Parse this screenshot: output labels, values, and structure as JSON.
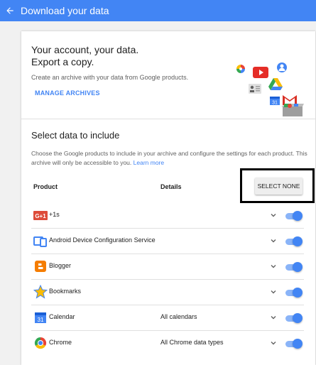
{
  "appbar": {
    "title": "Download your data"
  },
  "hero": {
    "heading_line1": "Your account, your data.",
    "heading_line2": "Export a copy.",
    "subtitle": "Create an archive with your data from Google products.",
    "manage_label": "MANAGE ARCHIVES"
  },
  "select": {
    "title": "Select data to include",
    "description": "Choose the Google products to include in your archive and configure the settings for each product. This archive will only be accessible to you.",
    "learn_more": "Learn more",
    "col_product": "Product",
    "col_details": "Details",
    "select_none_label": "SELECT NONE"
  },
  "products": [
    {
      "name": "+1s",
      "details": "",
      "icon": "google-plus-one-icon",
      "enabled": true
    },
    {
      "name": "Android Device Configuration Service",
      "details": "",
      "icon": "android-device-icon",
      "enabled": true
    },
    {
      "name": "Blogger",
      "details": "",
      "icon": "blogger-icon",
      "enabled": true
    },
    {
      "name": "Bookmarks",
      "details": "",
      "icon": "bookmarks-star-icon",
      "enabled": true
    },
    {
      "name": "Calendar",
      "details": "All calendars",
      "icon": "calendar-icon",
      "enabled": true
    },
    {
      "name": "Chrome",
      "details": "All Chrome data types",
      "icon": "chrome-icon",
      "enabled": true
    }
  ],
  "colors": {
    "accent": "#4285f4",
    "toggle_track": "#8ab4f8"
  }
}
